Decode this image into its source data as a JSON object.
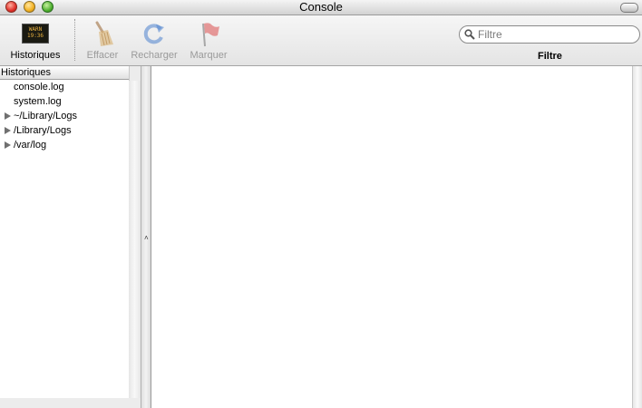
{
  "window": {
    "title": "Console"
  },
  "toolbar": {
    "historiques_label": "Historiques",
    "lcd_text": [
      "WARN",
      "19:36"
    ],
    "effacer_label": "Effacer",
    "recharger_label": "Recharger",
    "marquer_label": "Marquer",
    "search_placeholder": "Filtre",
    "filter_label": "Filtre"
  },
  "sidebar": {
    "header": "Historiques",
    "items": [
      {
        "label": "console.log",
        "expandable": false
      },
      {
        "label": "system.log",
        "expandable": false
      },
      {
        "label": "~/Library/Logs",
        "expandable": true
      },
      {
        "label": "/Library/Logs",
        "expandable": true
      },
      {
        "label": "/var/log",
        "expandable": true
      }
    ]
  },
  "colors": {
    "disabled_text": "#9a9a9a",
    "lcd_text": "#e8b040"
  }
}
